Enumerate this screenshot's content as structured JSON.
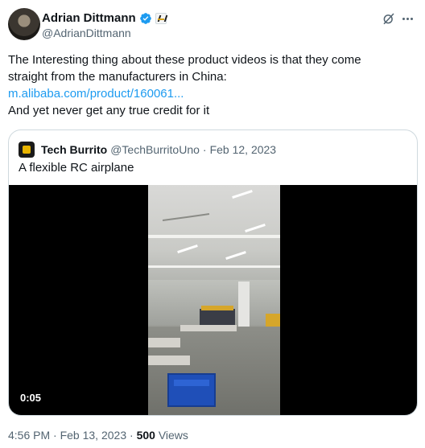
{
  "author": {
    "name": "Adrian Dittmann",
    "handle": "@AdrianDittmann"
  },
  "tweet": {
    "text_line1": "The Interesting thing about these product videos is that they come",
    "text_line2": "straight from the manufacturers in China:",
    "link": "m.alibaba.com/product/160061...",
    "text_line4": "And yet never get any true credit for it"
  },
  "quoted_tweet": {
    "name": "Tech Burrito",
    "handle": "@TechBurritoUno",
    "separator": "·",
    "date": "Feb 12, 2023",
    "text": "A flexible RC airplane",
    "video_duration": "0:05"
  },
  "footer": {
    "time": "4:56 PM",
    "separator1": "·",
    "date": "Feb 13, 2023",
    "separator2": "·",
    "views_count": "500",
    "views_label": "Views"
  },
  "icons": {
    "verified": "verified-badge-icon",
    "grok": "grok-icon",
    "more": "more-icon"
  },
  "colors": {
    "link": "#1d9bf0",
    "verified": "#1d9bf0",
    "secondary_text": "#536471"
  }
}
